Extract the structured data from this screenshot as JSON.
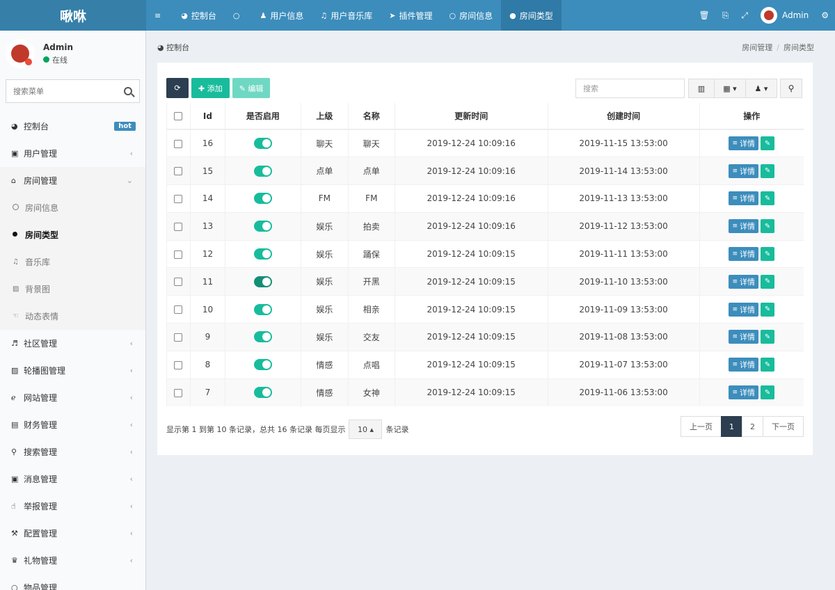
{
  "app": {
    "logo": "啾咻"
  },
  "topnav": [
    {
      "icon": "≡",
      "label": ""
    },
    {
      "icon": "◕",
      "label": "控制台"
    },
    {
      "icon": "○",
      "label": ""
    },
    {
      "icon": "♟",
      "label": "用户信息"
    },
    {
      "icon": "♫",
      "label": "用户音乐库"
    },
    {
      "icon": "➤",
      "label": "插件管理"
    },
    {
      "icon": "○",
      "label": "房间信息"
    },
    {
      "icon": "●",
      "label": "房间类型"
    }
  ],
  "topright": {
    "trash_icon": "🗑",
    "copy_icon": "⎘",
    "fullscreen_icon": "⤢",
    "user": "Admin",
    "settings_icon": "⚙"
  },
  "sidebar": {
    "user_name": "Admin",
    "user_status": "在线",
    "search_placeholder": "搜索菜单",
    "items": [
      {
        "icon": "◕",
        "label": "控制台",
        "badge": "hot"
      },
      {
        "icon": "▣",
        "label": "用户管理",
        "chev": "‹"
      },
      {
        "icon": "⌂",
        "label": "房间管理",
        "chev": "⌄"
      },
      {
        "icon": "♬",
        "label": "社区管理",
        "chev": "‹"
      },
      {
        "icon": "▨",
        "label": "轮播图管理",
        "chev": "‹"
      },
      {
        "icon": "ℯ",
        "label": "网站管理",
        "chev": "‹"
      },
      {
        "icon": "▤",
        "label": "财务管理",
        "chev": "‹"
      },
      {
        "icon": "⚲",
        "label": "搜索管理",
        "chev": "‹"
      },
      {
        "icon": "▣",
        "label": "消息管理",
        "chev": "‹"
      },
      {
        "icon": "☝",
        "label": "举报管理",
        "chev": "‹"
      },
      {
        "icon": "⚒",
        "label": "配置管理",
        "chev": "‹"
      },
      {
        "icon": "♛",
        "label": "礼物管理",
        "chev": "‹"
      },
      {
        "icon": "○",
        "label": "物品管理",
        "chev": ""
      }
    ],
    "sub": [
      {
        "label": "房间信息"
      },
      {
        "label": "房间类型"
      },
      {
        "icon": "♫",
        "label": "音乐库"
      },
      {
        "icon": "▨",
        "label": "背景图"
      },
      {
        "icon": "☜",
        "label": "动态表情"
      }
    ]
  },
  "breadcrumb": {
    "home": "控制台",
    "path1": "房间管理",
    "path2": "房间类型"
  },
  "toolbar": {
    "refresh_icon": "⟳",
    "add": "✚ 添加",
    "edit": "✎ 编辑",
    "search_placeholder": "搜索",
    "cols_icon": "▥",
    "grid_icon": "▦ ▾",
    "export_icon": "♟ ▾",
    "search_icon": "⚲"
  },
  "table": {
    "headers": [
      "",
      "Id",
      "是否启用",
      "上级",
      "名称",
      "更新时间",
      "创建时间",
      "操作"
    ],
    "rows": [
      {
        "id": "16",
        "enabled": true,
        "parent": "聊天",
        "name": "聊天",
        "updated": "2019-12-24 10:09:16",
        "created": "2019-11-15 13:53:00"
      },
      {
        "id": "15",
        "enabled": true,
        "parent": "点单",
        "name": "点单",
        "updated": "2019-12-24 10:09:16",
        "created": "2019-11-14 13:53:00"
      },
      {
        "id": "14",
        "enabled": true,
        "parent": "FM",
        "name": "FM",
        "updated": "2019-12-24 10:09:16",
        "created": "2019-11-13 13:53:00"
      },
      {
        "id": "13",
        "enabled": true,
        "parent": "娱乐",
        "name": "拍卖",
        "updated": "2019-12-24 10:09:16",
        "created": "2019-11-12 13:53:00"
      },
      {
        "id": "12",
        "enabled": true,
        "parent": "娱乐",
        "name": "踊保",
        "updated": "2019-12-24 10:09:15",
        "created": "2019-11-11 13:53:00"
      },
      {
        "id": "11",
        "enabled": true,
        "parent": "娱乐",
        "name": "开黑",
        "updated": "2019-12-24 10:09:15",
        "created": "2019-11-10 13:53:00"
      },
      {
        "id": "10",
        "enabled": true,
        "parent": "娱乐",
        "name": "相亲",
        "updated": "2019-12-24 10:09:15",
        "created": "2019-11-09 13:53:00"
      },
      {
        "id": "9",
        "enabled": true,
        "parent": "娱乐",
        "name": "交友",
        "updated": "2019-12-24 10:09:15",
        "created": "2019-11-08 13:53:00"
      },
      {
        "id": "8",
        "enabled": true,
        "parent": "情感",
        "name": "点唱",
        "updated": "2019-12-24 10:09:15",
        "created": "2019-11-07 13:53:00"
      },
      {
        "id": "7",
        "enabled": true,
        "parent": "情感",
        "name": "女神",
        "updated": "2019-12-24 10:09:15",
        "created": "2019-11-06 13:53:00"
      }
    ],
    "detail_label": "详情",
    "detail_icon": "≡",
    "edit_icon": "✎"
  },
  "footer": {
    "info_prefix": "显示第 1 到第 10 条记录，总共 16 条记录 每页显示",
    "page_size": "10 ▴",
    "info_suffix": "条记录",
    "prev": "上一页",
    "pages": [
      "1",
      "2"
    ],
    "next": "下一页"
  }
}
